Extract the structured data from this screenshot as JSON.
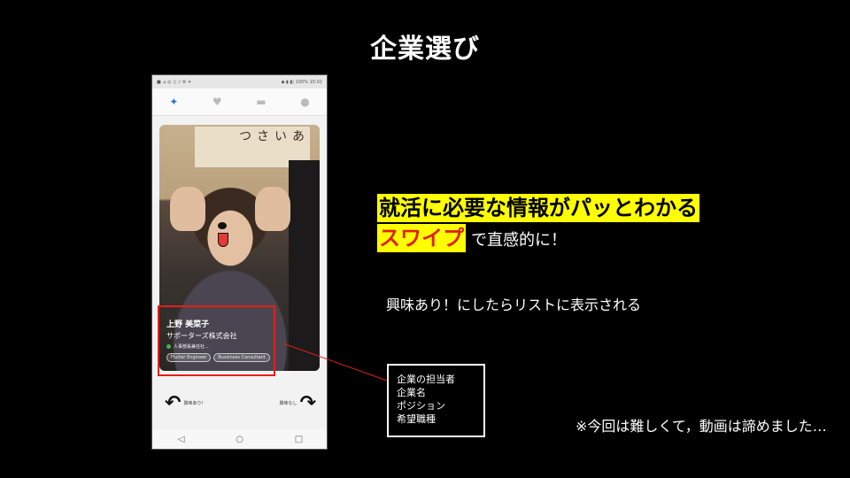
{
  "slide": {
    "title": "企業選び",
    "headline_line1": "就活に必要な情報がパッとわかる",
    "headline_line2_highlight": "スワイプ",
    "headline_line2_rest": "で直感的に！",
    "note_list": "興味あり！にしたらリストに表示される",
    "note_video": "※今回は難しくて，動画は諦めました…",
    "infobox_lines": [
      "企業の担当者",
      "企業名",
      "ポジション",
      "希望職種"
    ]
  },
  "phone": {
    "statusbar_left": "■ ⊿ ◎ ♫ ♪ ⚙ ✦",
    "statusbar_right": "◆ ▮ ◧ 100% 15:02",
    "nav_icons": [
      "app-logo-icon",
      "heart-icon",
      "chat-icon",
      "profile-icon"
    ],
    "card": {
      "signboard": "あいさつ",
      "name": "上野 美菜子",
      "company": "サポーターズ株式会社",
      "position": "人事部長兼任社...",
      "chips": [
        "Flutter Engineer",
        "Bussiness Consultant"
      ]
    },
    "swipe_left_label": "興味あり！",
    "swipe_right_label": "興味なし",
    "android_nav": [
      "◁",
      "○",
      "□"
    ]
  },
  "colors": {
    "highlight_yellow": "#ffff00",
    "accent_red": "#e0201b",
    "background": "#000000"
  }
}
